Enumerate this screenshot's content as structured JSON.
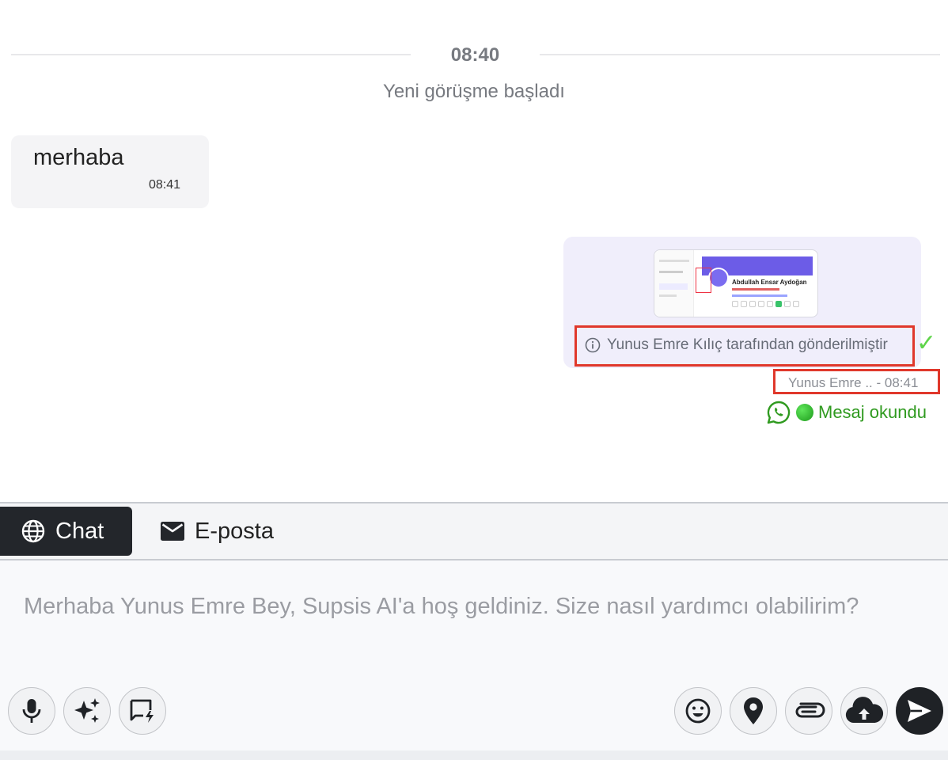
{
  "conversation": {
    "divider_time": "08:40",
    "session_started": "Yeni görüşme başladı",
    "incoming": {
      "text": "merhaba",
      "time": "08:41"
    },
    "outgoing": {
      "preview": {
        "name": "Abdullah Ensar Aydoğan"
      },
      "sent_by": "Yunus Emre Kılıç tarafından gönderilmiştir",
      "meta": "Yunus Emre .. - 08:41",
      "status": "Mesaj okundu"
    }
  },
  "tabs": [
    {
      "label": "Chat",
      "icon": "globe-icon",
      "active": true
    },
    {
      "label": "E-posta",
      "icon": "mail-icon",
      "active": false
    }
  ],
  "composer": {
    "placeholder": "Merhaba Yunus Emre Bey, Supsis AI'a hoş geldiniz. Size nasıl yardımcı olabilirim?"
  },
  "toolbar": {
    "left": [
      "microphone-icon",
      "sparkles-icon",
      "quick-reply-icon"
    ],
    "right": [
      "emoji-icon",
      "location-pin-icon",
      "paperclip-icon",
      "cloud-upload-icon",
      "send-icon"
    ]
  },
  "colors": {
    "accent": "#6c5ce7",
    "read_status": "#2f9a1f",
    "highlight_box": "#e0382b",
    "active_tab": "#23262b"
  }
}
